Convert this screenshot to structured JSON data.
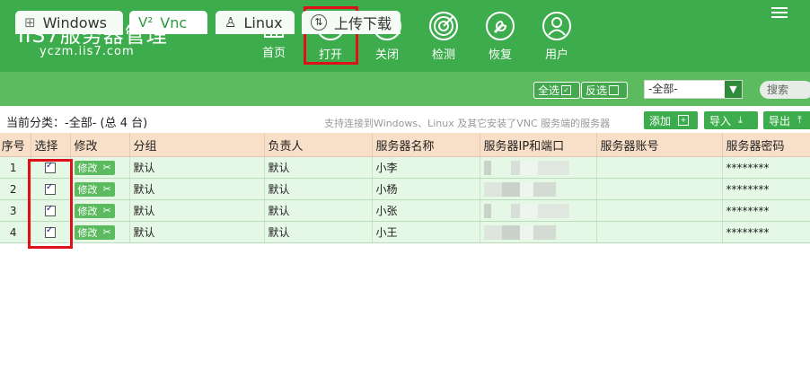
{
  "header": {
    "logo_title": "IIS7服务器管理",
    "logo_url": "yczm.iis7.com",
    "nav": [
      {
        "label": "首页",
        "icon": "home-icon"
      },
      {
        "label": "打开",
        "icon": "link-icon"
      },
      {
        "label": "关闭",
        "icon": "unlink-icon"
      },
      {
        "label": "检测",
        "icon": "radar-icon"
      },
      {
        "label": "恢复",
        "icon": "wrench-icon"
      },
      {
        "label": "用户",
        "icon": "user-icon"
      }
    ]
  },
  "tabs": [
    {
      "label": "Windows",
      "icon": "windows-icon"
    },
    {
      "label": "Vnc",
      "icon": "vnc-icon",
      "active": true
    },
    {
      "label": "Linux",
      "icon": "linux-icon"
    },
    {
      "label": "上传下载",
      "icon": "transfer-icon"
    }
  ],
  "toolbar": {
    "select_all": "全选",
    "invert_select": "反选",
    "category_value": "-全部-",
    "search_placeholder": "搜索"
  },
  "info": {
    "current_label": "当前分类：",
    "current_value": "-全部- (总 4 台)",
    "hint": "支持连接到Windows、Linux 及其它安装了VNC 服务端的服务器",
    "add": "添加",
    "import": "导入",
    "export": "导出"
  },
  "table": {
    "columns": [
      "序号",
      "选择",
      "修改",
      "分组",
      "负责人",
      "服务器名称",
      "服务器IP和端口",
      "服务器账号",
      "服务器密码"
    ],
    "edit_label": "修改",
    "rows": [
      {
        "no": "1",
        "group": "默认",
        "owner": "默认",
        "name": "小李",
        "account": "",
        "password": "********",
        "checked": true
      },
      {
        "no": "2",
        "group": "默认",
        "owner": "默认",
        "name": "小杨",
        "account": "",
        "password": "********",
        "checked": true
      },
      {
        "no": "3",
        "group": "默认",
        "owner": "默认",
        "name": "小张",
        "account": "",
        "password": "********",
        "checked": true
      },
      {
        "no": "4",
        "group": "默认",
        "owner": "默认",
        "name": "小王",
        "account": "",
        "password": "********",
        "checked": true
      }
    ]
  },
  "colors": {
    "header_green": "#3dac4c",
    "tabbar_green": "#5cbb5f",
    "row_green": "#e5f7e5",
    "header_peach": "#f8dfc8",
    "highlight_red": "#e0101a"
  }
}
